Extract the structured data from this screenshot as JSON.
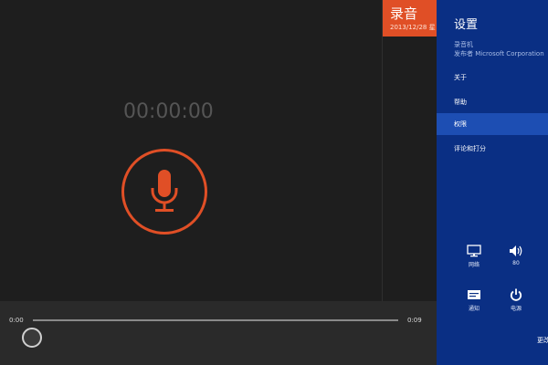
{
  "app": {
    "title": "录音",
    "date": "2013/12/28 星",
    "timer": "00:00:00",
    "accent_color": "#e04f26",
    "record_button_icon": "microphone-icon"
  },
  "player": {
    "time_start": "0:00",
    "time_end": "0:09",
    "position_fraction": 0
  },
  "settings": {
    "heading": "设置",
    "app_name": "录音机",
    "publisher": "发布者 Microsoft Corporation",
    "menu": [
      {
        "label": "关于"
      },
      {
        "label": "帮助"
      },
      {
        "label": "权限",
        "selected": true
      },
      {
        "label": "评论和打分"
      }
    ],
    "quick": [
      {
        "icon": "network-icon",
        "label": "网络"
      },
      {
        "icon": "volume-icon",
        "label": "80"
      },
      {
        "icon": "notifications-icon",
        "label": "通知"
      },
      {
        "icon": "power-icon",
        "label": "电源"
      }
    ],
    "more_label": "更改",
    "panel_color": "#0a2f84"
  }
}
